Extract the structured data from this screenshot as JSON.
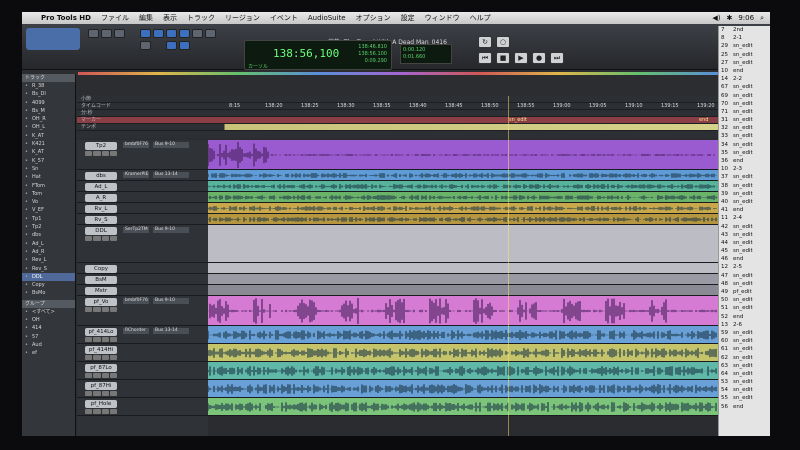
{
  "menu": {
    "app_name": "Pro Tools HD",
    "items": [
      "ファイル",
      "編集",
      "表示",
      "トラック",
      "リージョン",
      "イベント",
      "AudioSuite",
      "オプション",
      "設定",
      "ウィンドウ",
      "ヘルプ"
    ],
    "clock": "9:06"
  },
  "session": {
    "title": "編集: The Travel With A Dead Man_0416"
  },
  "counter": {
    "main": "138:56,100",
    "label": "カーソル",
    "start": "138:46.810",
    "end": "138:56.100",
    "length": "0:09.290",
    "sub_a": "0:00.120",
    "sub_b": "0:01.660"
  },
  "track_list": {
    "header": "トラック",
    "items": [
      "R_38",
      "Bs_DI",
      "4099",
      "Bs_M",
      "OH_R",
      "OH_L",
      "K_AT",
      "K421",
      "K_AT",
      "K_57",
      "Sn",
      "Hat",
      "FTom",
      "Tom",
      "Vo",
      "V_EF",
      "Tp1",
      "Tp2",
      "dbs",
      "Ad_L",
      "Ad_R",
      "Rev_L",
      "Rev_S",
      "DDL",
      "Copy",
      "BsMo"
    ],
    "selected_index": 23,
    "groups_header": "グループ",
    "groups": [
      "<すべて>",
      "OH",
      "414",
      "57",
      "Aud",
      "ef"
    ]
  },
  "rulers": {
    "labels": [
      "小節",
      "タイムコード",
      "分:秒",
      "マーカー",
      "テンポ"
    ],
    "ticks": [
      "8:15",
      "138:20",
      "138:25",
      "138:30",
      "138:35",
      "138:40",
      "138:45",
      "138:50",
      "138:55",
      "139:00",
      "139:05",
      "139:10",
      "139:15",
      "139:20"
    ],
    "marker_labels": [
      "sn_edit",
      "end"
    ]
  },
  "tracks": [
    {
      "name": "Tp2",
      "insert": "bmbf0F76",
      "io": "Bus 9-10",
      "color": "#9a5ad0"
    },
    {
      "name": "dbs",
      "insert": "KramerPIE",
      "io": "Bus 13-14",
      "color": "#5f9bd6"
    },
    {
      "name": "Ad_L",
      "insert": "",
      "io": "",
      "color": "#57b39a"
    },
    {
      "name": "A_R",
      "insert": "",
      "io": "",
      "color": "#6cb36a"
    },
    {
      "name": "Rv_L",
      "insert": "",
      "io": "",
      "color": "#c8a84a"
    },
    {
      "name": "Rv_S",
      "insert": "",
      "io": "",
      "color": "#b6963e"
    },
    {
      "name": "DDL",
      "insert": "SerTp2TM",
      "io": "Bus 9-10",
      "color": "#bcbcc4"
    },
    {
      "name": "Copy",
      "insert": "",
      "io": "",
      "color": "#bcbcc4"
    },
    {
      "name": "BsM",
      "insert": "",
      "io": "",
      "color": "#9a9aa4"
    },
    {
      "name": "Mstr",
      "insert": "",
      "io": "",
      "color": "#8a8a94"
    },
    {
      "name": "pf_Vo",
      "insert": "bmbf0F76",
      "io": "Bus 9-10",
      "color": "#d57bd4"
    },
    {
      "name": "pf_414Lo",
      "insert": "RChorder",
      "io": "Bus 13-14",
      "color": "#6aa0d8"
    },
    {
      "name": "pf_414Hi",
      "insert": "",
      "io": "",
      "color": "#c6c46a"
    },
    {
      "name": "pf_87Lo",
      "insert": "",
      "io": "",
      "color": "#5fb8a8"
    },
    {
      "name": "pf_87Hi",
      "insert": "",
      "io": "",
      "color": "#6aa0d8"
    },
    {
      "name": "pf_Hole",
      "insert": "",
      "io": "",
      "color": "#7cc47a"
    }
  ],
  "markers": [
    {
      "n": "7",
      "t": "2nd"
    },
    {
      "n": "8",
      "t": "2-1"
    },
    {
      "n": "29",
      "t": "sn_edit"
    },
    {
      "n": "25",
      "t": "sn_edit"
    },
    {
      "n": "27",
      "t": "sn_edit"
    },
    {
      "n": "10",
      "t": "end"
    },
    {
      "n": "14",
      "t": "2-2"
    },
    {
      "n": "67",
      "t": "sn_edit"
    },
    {
      "n": "69",
      "t": "sn_edit"
    },
    {
      "n": "70",
      "t": "sn_edit"
    },
    {
      "n": "71",
      "t": "sn_edit"
    },
    {
      "n": "31",
      "t": "sn_edit"
    },
    {
      "n": "32",
      "t": "sn_edit"
    },
    {
      "n": "33",
      "t": "sn_edit"
    },
    {
      "n": "34",
      "t": "sn_edit"
    },
    {
      "n": "35",
      "t": "sn_edit"
    },
    {
      "n": "36",
      "t": "end"
    },
    {
      "n": "10",
      "t": "2-3"
    },
    {
      "n": "37",
      "t": "sn_edit"
    },
    {
      "n": "38",
      "t": "sn_edit"
    },
    {
      "n": "39",
      "t": "sn_edit"
    },
    {
      "n": "40",
      "t": "sn_edit"
    },
    {
      "n": "41",
      "t": "end"
    },
    {
      "n": "11",
      "t": "2-4"
    },
    {
      "n": "42",
      "t": "sn_edit"
    },
    {
      "n": "43",
      "t": "sn_edit"
    },
    {
      "n": "44",
      "t": "sn_edit"
    },
    {
      "n": "45",
      "t": "sn_edit"
    },
    {
      "n": "46",
      "t": "end"
    },
    {
      "n": "12",
      "t": "2-5"
    },
    {
      "n": "47",
      "t": "sn_edit"
    },
    {
      "n": "48",
      "t": "sn_edit"
    },
    {
      "n": "49",
      "t": "pf_edit"
    },
    {
      "n": "50",
      "t": "sn_edit"
    },
    {
      "n": "51",
      "t": "sn_edit"
    },
    {
      "n": "52",
      "t": "end"
    },
    {
      "n": "13",
      "t": "2-6"
    },
    {
      "n": "59",
      "t": "sn_edit"
    },
    {
      "n": "60",
      "t": "sn_edit"
    },
    {
      "n": "61",
      "t": "sn_edit"
    },
    {
      "n": "62",
      "t": "sn_edit"
    },
    {
      "n": "63",
      "t": "sn_edit"
    },
    {
      "n": "64",
      "t": "sn_edit"
    },
    {
      "n": "53",
      "t": "sn_edit"
    },
    {
      "n": "54",
      "t": "sn_edit"
    },
    {
      "n": "55",
      "t": "sn_edit"
    },
    {
      "n": "56",
      "t": "end"
    }
  ]
}
